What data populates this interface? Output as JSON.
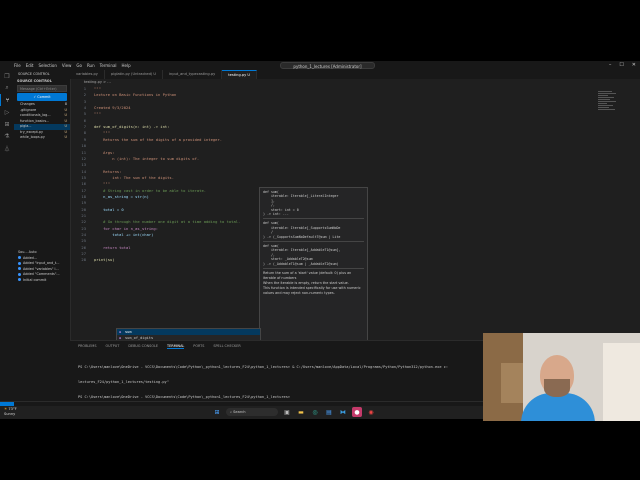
{
  "window": {
    "menu": [
      "File",
      "Edit",
      "Selection",
      "View",
      "Go",
      "Run",
      "Terminal",
      "Help"
    ],
    "command_center": "python_1_lectures [Administrator]"
  },
  "activity_bar": [
    "explorer-icon",
    "search-icon",
    "source-control-icon",
    "run-debug-icon",
    "extensions-icon",
    "testing-icon",
    "flask-icon"
  ],
  "sidebar": {
    "title": "SOURCE CONTROL",
    "section": "SOURCE CONTROL",
    "message_placeholder": "Message (Ctrl+Enter)",
    "commit_label": "✓ Commit",
    "changes_label": "Changes",
    "changes_count": "8",
    "files": [
      {
        "name": ".gitignore",
        "status": "U"
      },
      {
        "name": "conditionals_log...",
        "status": "U"
      },
      {
        "name": "function_basics...",
        "status": "U"
      },
      {
        "name": "pigla...",
        "status": "U"
      },
      {
        "name": "try_except.py",
        "status": "U"
      },
      {
        "name": "while_loops.py",
        "status": "U"
      }
    ],
    "graph_title": "Sou... Auto",
    "graph_items": [
      "Added...",
      "Added \"input_and_t...",
      "Added \"variables\" l...",
      "Added \"Comments\"...",
      "Initial commit"
    ]
  },
  "tabs": [
    "variables.py",
    "piglatin.py (Untracked) U",
    "input_and_typecasting.py",
    "testing.py U"
  ],
  "breadcrumb": "testing.py > ...",
  "editor": {
    "line_numbers": [
      "1",
      "2",
      "3",
      "4",
      "5",
      "6",
      "7",
      "8",
      "9",
      "10",
      "11",
      "12",
      "13",
      "14",
      "15",
      "16",
      "17",
      "18",
      "19",
      "20",
      "21",
      "22",
      "23",
      "24",
      "25",
      "26",
      "27",
      "28"
    ],
    "lines": [
      {
        "t": "\"\"\"",
        "c": "c-str"
      },
      {
        "t": "Lecture on Basic Functions in Python",
        "c": "c-str"
      },
      {
        "t": "",
        "c": "c-pl"
      },
      {
        "t": "Created 9/3/2024",
        "c": "c-str"
      },
      {
        "t": "\"\"\"",
        "c": "c-str"
      },
      {
        "t": "",
        "c": "c-pl"
      },
      {
        "t": "def sum_of_digits(n: int) -> int:",
        "c": "c-fn"
      },
      {
        "t": "    \"\"\"",
        "c": "c-str"
      },
      {
        "t": "    Returns the sum of the digits of a provided integer.",
        "c": "c-str"
      },
      {
        "t": "",
        "c": "c-pl"
      },
      {
        "t": "    Args:",
        "c": "c-str"
      },
      {
        "t": "        n (int): The integer to sum digits of.",
        "c": "c-str"
      },
      {
        "t": "",
        "c": "c-pl"
      },
      {
        "t": "    Returns:",
        "c": "c-str"
      },
      {
        "t": "        int: The sum of the digits.",
        "c": "c-str"
      },
      {
        "t": "    \"\"\"",
        "c": "c-str"
      },
      {
        "t": "    # String cast in order to be able to iterate.",
        "c": "c-cm"
      },
      {
        "t": "    n_as_string = str(n)",
        "c": "c-var"
      },
      {
        "t": "",
        "c": "c-pl"
      },
      {
        "t": "    total = 0",
        "c": "c-var"
      },
      {
        "t": "",
        "c": "c-pl"
      },
      {
        "t": "    # Go through the number one digit at a time adding to total.",
        "c": "c-cm"
      },
      {
        "t": "    for char in n_as_string:",
        "c": "c-ctl"
      },
      {
        "t": "        total += int(char)",
        "c": "c-var"
      },
      {
        "t": "",
        "c": "c-pl"
      },
      {
        "t": "    return total",
        "c": "c-ctl"
      },
      {
        "t": "",
        "c": "c-pl"
      },
      {
        "t": "print(su)",
        "c": "c-fn"
      }
    ]
  },
  "hover": {
    "signatures": [
      "def sum(\n    iterable: Iterable[_LiteralInteger\n    ],\n    /,\n    start: int = 0\n) -> int: ...",
      "def sum(\n    iterable: Iterable[_SupportsSumNoDe\n    /\n) -> (_SupportsSumNoDefaultT@sum | Lite",
      "def sum(\n    iterable: Iterable[_AddableT1@sum],\n    /,\n    start: _AddableT2@sum\n) -> (_AddableT1@sum | _AddableT2@sum)"
    ],
    "doc": [
      "Return the sum of a 'start' value (default: 0) plus an iterable of numbers",
      "When the iterable is empty, return the start value.",
      "This function is intended specifically for use with numeric values and may reject non-numeric types."
    ]
  },
  "suggestions": [
    {
      "label": "sum",
      "selected": true
    },
    {
      "label": "sum_of_digits",
      "selected": false
    },
    {
      "label": "super",
      "selected": false
    }
  ],
  "panel": {
    "tabs": [
      "PROBLEMS",
      "OUTPUT",
      "DEBUG CONSOLE",
      "TERMINAL",
      "PORTS",
      "SPELL CHECKER"
    ],
    "active_tab": "TERMINAL",
    "terminal_lines": [
      "PS C:\\Users\\manlove\\OneDrive - VCCS\\Documents\\Code\\Python\\_python1_lectures_F24\\python_1_lectures> & C:/Users/manlove/AppData/Local/Programs/Python/Python312/python.exe c:",
      "lectures_F24/python_1_lectures/testing.py\"",
      "PS C:\\Users\\manlove\\OneDrive - VCCS\\Documents\\Code\\Python\\_python1_lectures_F24\\python_1_lectures>"
    ]
  },
  "taskbar": {
    "weather_temp": "73°F",
    "weather_desc": "Sunny",
    "search_label": "Search"
  }
}
